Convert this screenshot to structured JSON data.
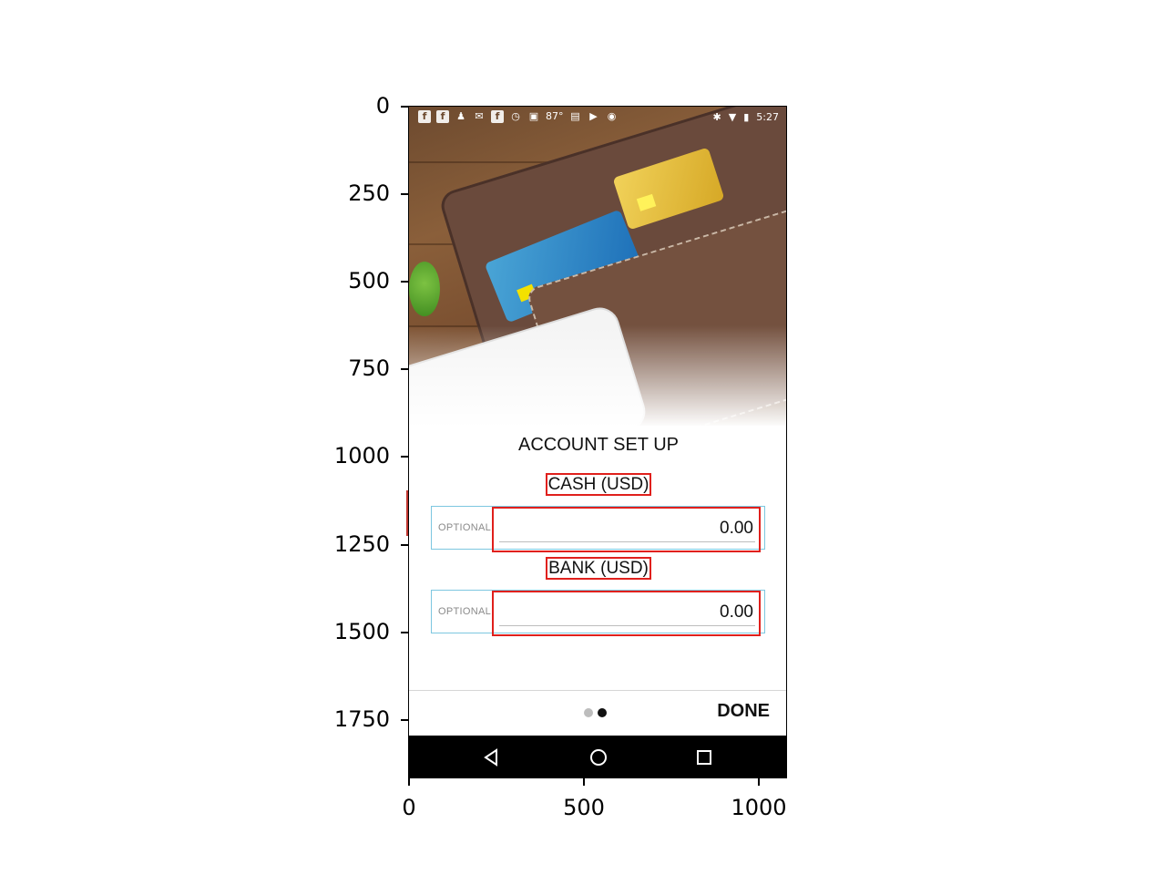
{
  "axes": {
    "y_ticks": [
      "0",
      "250",
      "500",
      "750",
      "1000",
      "1250",
      "1500",
      "1750"
    ],
    "x_ticks": [
      "0",
      "500",
      "1000"
    ]
  },
  "status_bar": {
    "temperature": "87°",
    "time": "5:27",
    "icons": [
      "facebook-icon",
      "facebook-icon",
      "notification-icon",
      "mail-icon",
      "facebook-icon",
      "alarm-icon",
      "lock-icon",
      "bag-icon",
      "youtube-icon",
      "android-icon",
      "bluetooth-icon",
      "wifi-icon",
      "battery-icon"
    ]
  },
  "setup": {
    "title": "ACCOUNT SET UP",
    "cash": {
      "label": "CASH (USD)",
      "hint": "OPTIONAL",
      "value": "0.00"
    },
    "bank": {
      "label": "BANK (USD)",
      "hint": "OPTIONAL",
      "value": "0.00"
    }
  },
  "footer": {
    "pager_total": 2,
    "pager_active": 2,
    "done_label": "DONE"
  },
  "nav": {
    "back": "back-icon",
    "home": "home-icon",
    "recents": "recents-icon"
  },
  "colors": {
    "highlight": "#e0201c",
    "field_border": "#7dc7e0",
    "nav_bar": "#000000"
  }
}
